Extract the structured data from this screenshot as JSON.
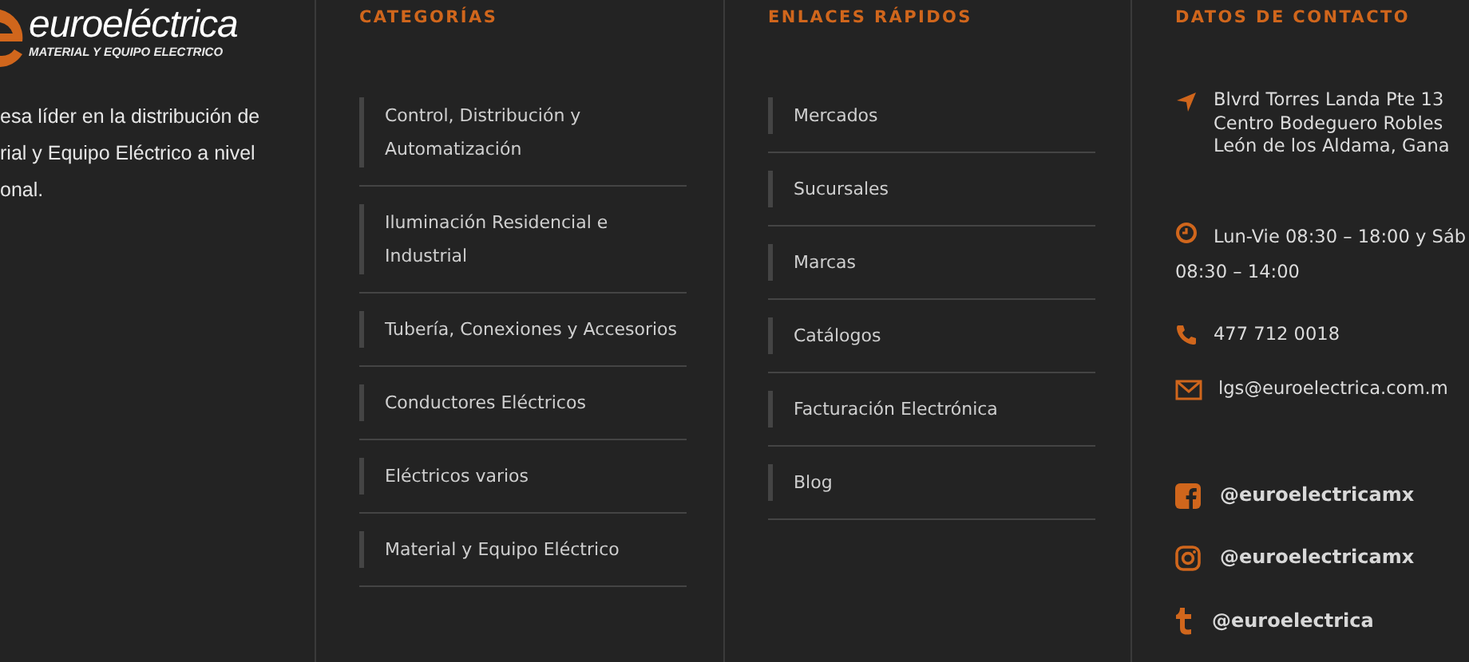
{
  "brand": {
    "name": "euroeléctrica",
    "tagline": "MATERIAL Y EQUIPO ELECTRICO",
    "about_lines": [
      "esa líder en la distribución de",
      "rial y Equipo Eléctrico a nivel",
      "onal."
    ]
  },
  "columns": [
    {
      "heading": "CATEGORÍAS",
      "items": [
        "Control, Distribución y Automatización",
        "Iluminación Residencial e Industrial",
        "Tubería, Conexiones y Accesorios",
        "Conductores Eléctricos",
        "Eléctricos varios",
        "Material y Equipo Eléctrico"
      ]
    },
    {
      "heading": "ENLACES RÁPIDOS",
      "items": [
        "Mercados",
        "Sucursales",
        "Marcas",
        "Catálogos",
        "Facturación Electrónica",
        "Blog"
      ]
    }
  ],
  "contact": {
    "heading": "DATOS DE CONTACTO",
    "entries": [
      {
        "kind": "address",
        "lines": [
          "Blvrd Torres Landa Pte 13",
          "Centro Bodeguero Robles",
          "León de los Aldama, Gana"
        ]
      },
      {
        "kind": "hours",
        "lines": [
          "Lun-Vie 08:30 – 18:00 y Sáb",
          "08:30 – 14:00"
        ]
      },
      {
        "kind": "phone",
        "lines": [
          "477 712 0018"
        ]
      },
      {
        "kind": "email",
        "lines": [
          "lgs@euroelectrica.com.m"
        ]
      }
    ],
    "social": [
      {
        "kind": "facebook",
        "handle": "@euroelectricamx"
      },
      {
        "kind": "instagram",
        "handle": "@euroelectricamx"
      },
      {
        "kind": "tumblr",
        "handle": "@euroelectrica"
      }
    ]
  }
}
